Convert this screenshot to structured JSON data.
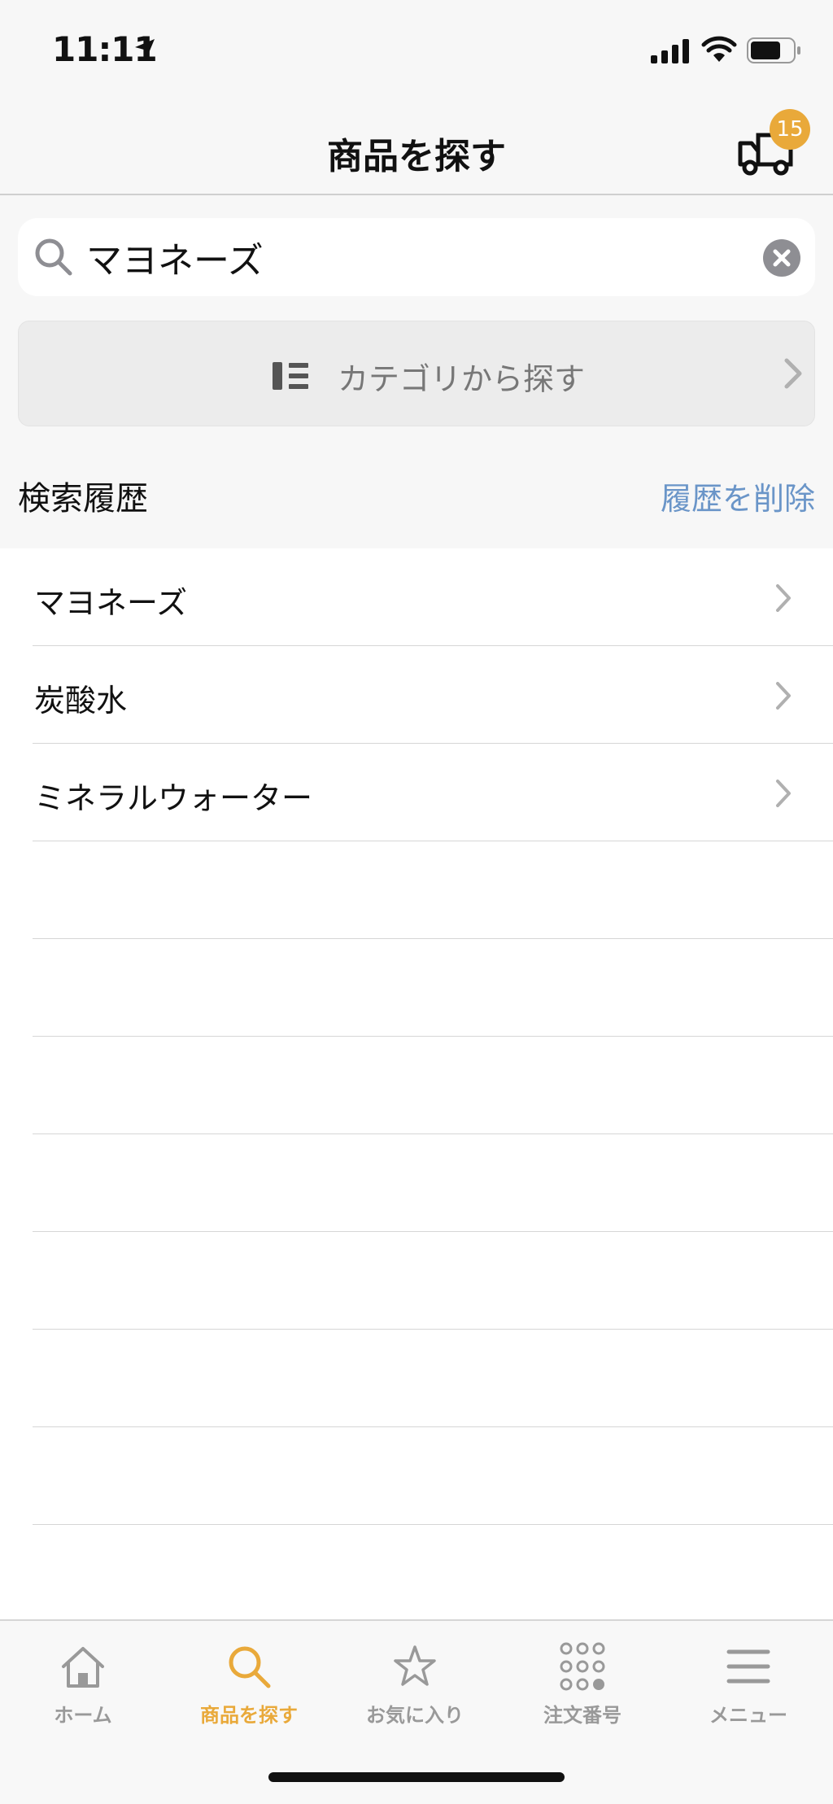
{
  "status_bar": {
    "time": "11:11"
  },
  "header": {
    "title": "商品を探す",
    "cart_count": "15"
  },
  "search": {
    "value": "マヨネーズ",
    "placeholder": ""
  },
  "category": {
    "label": "カテゴリから探す"
  },
  "history": {
    "title": "検索履歴",
    "clear_label": "履歴を削除",
    "items": [
      {
        "label": "マヨネーズ"
      },
      {
        "label": "炭酸水"
      },
      {
        "label": "ミネラルウォーター"
      }
    ]
  },
  "tabs": [
    {
      "label": "ホーム",
      "icon": "home-icon",
      "active": false
    },
    {
      "label": "商品を探す",
      "icon": "search-icon",
      "active": true
    },
    {
      "label": "お気に入り",
      "icon": "star-icon",
      "active": false
    },
    {
      "label": "注文番号",
      "icon": "grid-icon",
      "active": false
    },
    {
      "label": "メニュー",
      "icon": "menu-icon",
      "active": false
    }
  ],
  "colors": {
    "accent": "#e9a93a",
    "link": "#6a95c8",
    "badge": "#e9a93a"
  }
}
